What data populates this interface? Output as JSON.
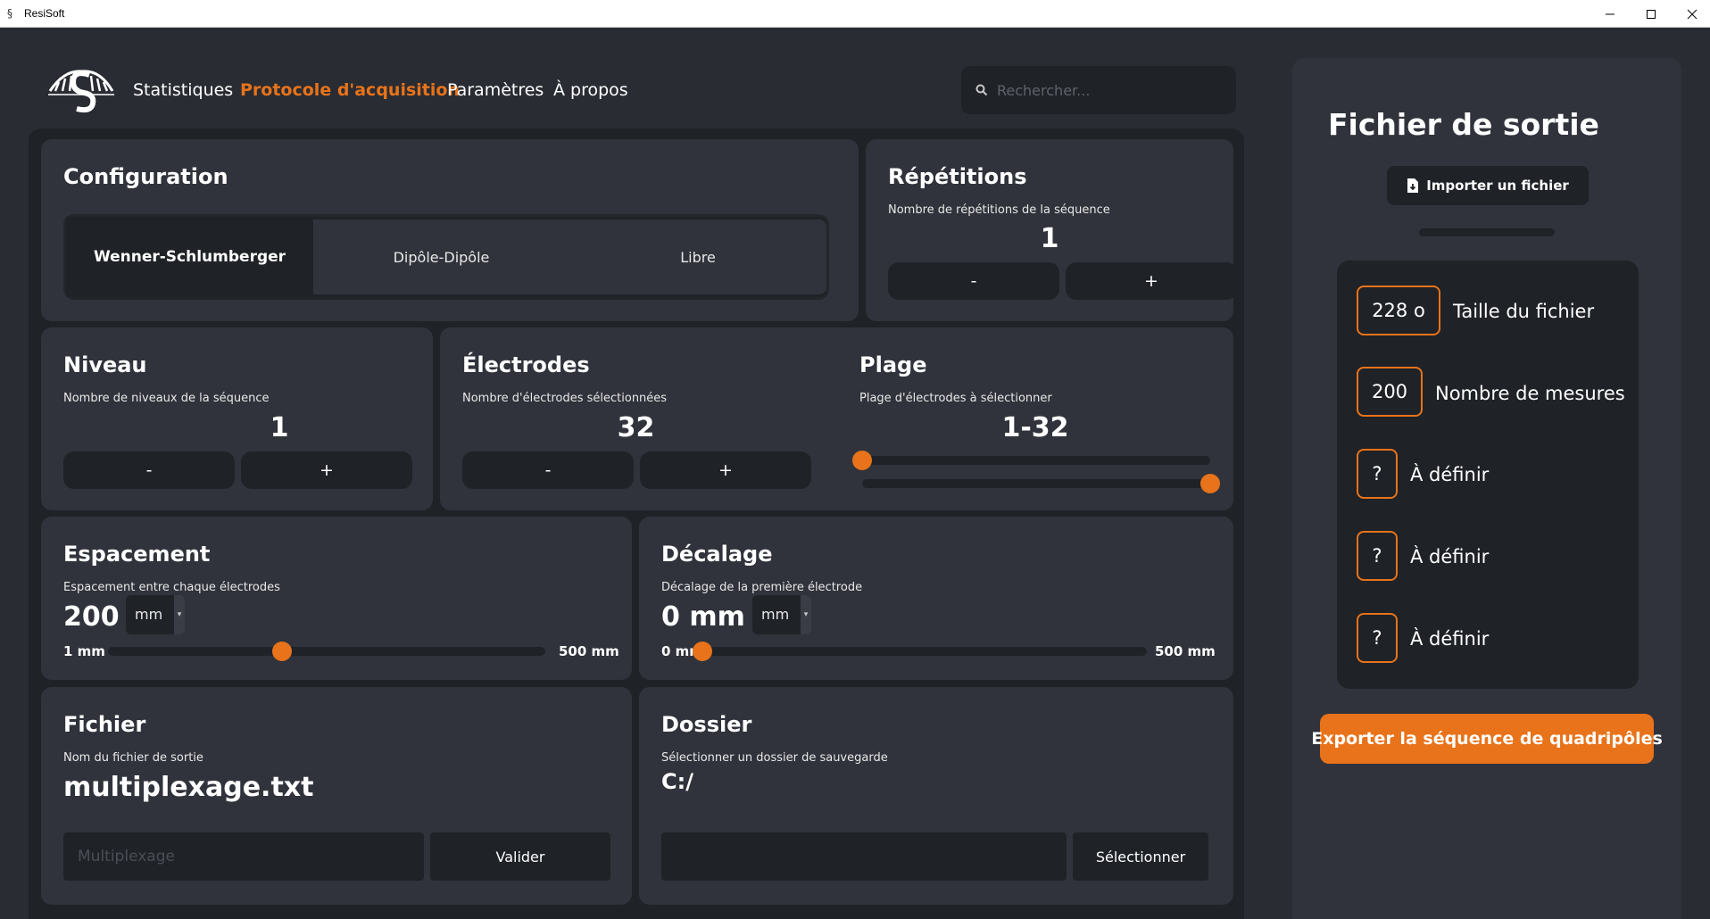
{
  "window": {
    "title": "ResiSoft"
  },
  "nav": {
    "items": [
      {
        "label": "Statistiques"
      },
      {
        "label": "Protocole d'acquisition"
      },
      {
        "label": "Paramètres"
      },
      {
        "label": "À propos"
      }
    ],
    "active_index": 1
  },
  "search": {
    "placeholder": "Rechercher..."
  },
  "colors": {
    "accent": "#e8731a",
    "background": "#292c33",
    "card": "#30333b",
    "dark": "#1f2227"
  },
  "configuration": {
    "title": "Configuration",
    "options": [
      "Wenner-Schlumberger",
      "Dipôle-Dipôle",
      "Libre"
    ],
    "selected": "Wenner-Schlumberger"
  },
  "repetitions": {
    "title": "Répétitions",
    "subtitle": "Nombre de répétitions de la séquence",
    "value": "1",
    "minus": "-",
    "plus": "+"
  },
  "niveau": {
    "title": "Niveau",
    "subtitle": "Nombre de niveaux de la séquence",
    "value": "1",
    "minus": "-",
    "plus": "+"
  },
  "electrodes": {
    "title": "Électrodes",
    "subtitle": "Nombre d'électrodes sélectionnées",
    "value": "32",
    "minus": "-",
    "plus": "+"
  },
  "plage": {
    "title": "Plage",
    "subtitle": "Plage d'électrodes à sélectionner",
    "value": "1-32",
    "range_min": 1,
    "range_max": 32,
    "selected_min": 1,
    "selected_max": 32
  },
  "espacement": {
    "title": "Espacement",
    "subtitle": "Espacement entre chaque électrodes",
    "value": "200",
    "unit": "mm",
    "min_label": "1 mm",
    "max_label": "500 mm",
    "slider_min": 1,
    "slider_max": 500,
    "slider_value": 200
  },
  "decalage": {
    "title": "Décalage",
    "subtitle": "Décalage de la première électrode",
    "value": "0 mm",
    "unit": "mm",
    "min_label": "0 mm",
    "max_label": "500 mm",
    "slider_min": 0,
    "slider_max": 500,
    "slider_value": 0
  },
  "fichier": {
    "title": "Fichier",
    "subtitle": "Nom du fichier de sortie",
    "value": "multiplexage.txt",
    "input_placeholder": "Multiplexage",
    "button": "Valider"
  },
  "dossier": {
    "title": "Dossier",
    "subtitle": "Sélectionner un dossier de sauvegarde",
    "value": "C:/",
    "button": "Sélectionner"
  },
  "output": {
    "title": "Fichier de sortie",
    "import_label": "Importer un fichier",
    "stats": [
      {
        "value": "228 o",
        "label": "Taille du fichier"
      },
      {
        "value": "200",
        "label": "Nombre de mesures"
      },
      {
        "value": "?",
        "label": "À définir"
      },
      {
        "value": "?",
        "label": "À définir"
      },
      {
        "value": "?",
        "label": "À définir"
      }
    ],
    "export_label": "Exporter la séquence de quadripôles"
  }
}
